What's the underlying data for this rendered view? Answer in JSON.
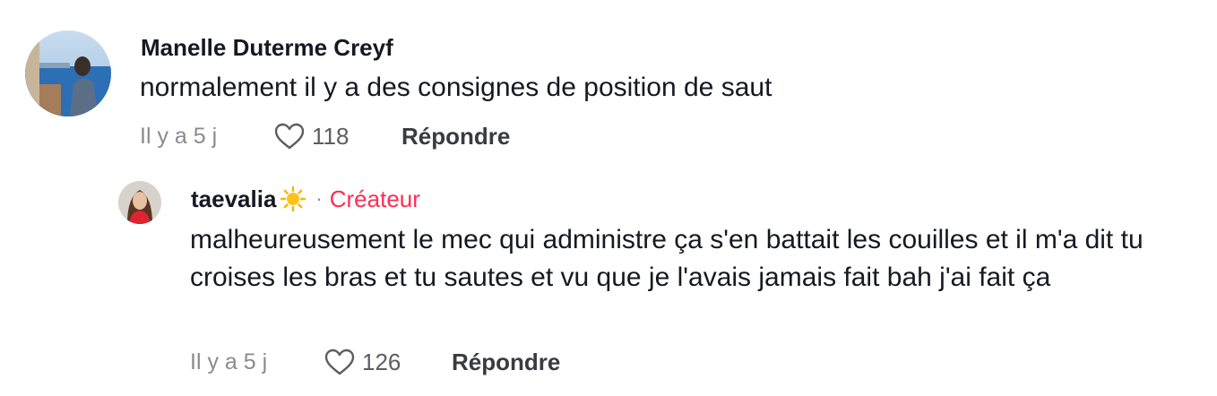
{
  "comments": [
    {
      "username": "Manelle Duterme Creyf",
      "text": "normalement il y a des consignes de position de saut",
      "time": "Il y a 5 j",
      "likes": "118",
      "reply_label": "Répondre",
      "avatar_icon": "profile-photo"
    },
    {
      "username": "taevalia",
      "username_emoji": "sun-emoji",
      "separator": "·",
      "badge": "Créateur",
      "badge_color": "#fe2c55",
      "text": "malheureusement le mec qui administre ça s'en battait les couilles et il m'a dit tu croises les bras et tu sautes et vu que je l'avais jamais fait bah j'ai fait ça",
      "time": "Il y a 5 j",
      "likes": "126",
      "reply_label": "Répondre",
      "avatar_icon": "profile-photo"
    }
  ],
  "icons": {
    "like": "heart-outline-icon"
  }
}
